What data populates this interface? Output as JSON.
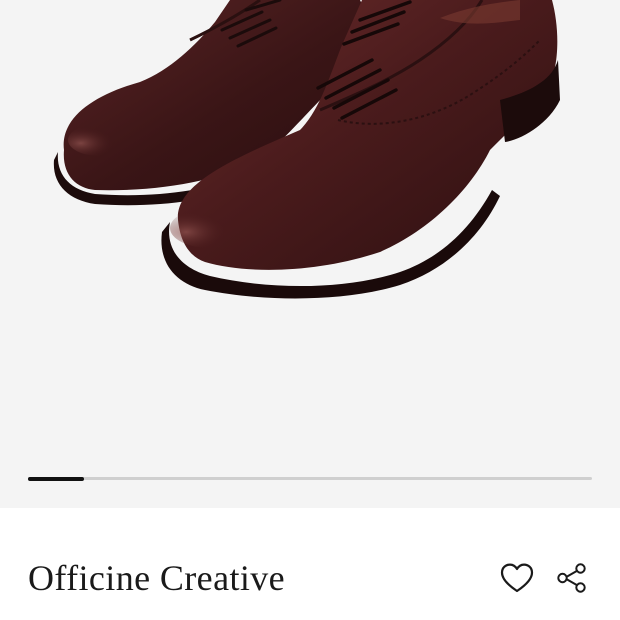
{
  "product": {
    "brand": "Officine Creative",
    "image_subject": "brown leather derby shoes"
  },
  "gallery": {
    "progress": 0.1
  },
  "actions": {
    "favorite_icon": "heart-icon",
    "share_icon": "share-icon"
  },
  "colors": {
    "background": "#f4f4f4",
    "track": "#cfcfcf",
    "indicator": "#111111",
    "text": "#1a1a1a"
  }
}
